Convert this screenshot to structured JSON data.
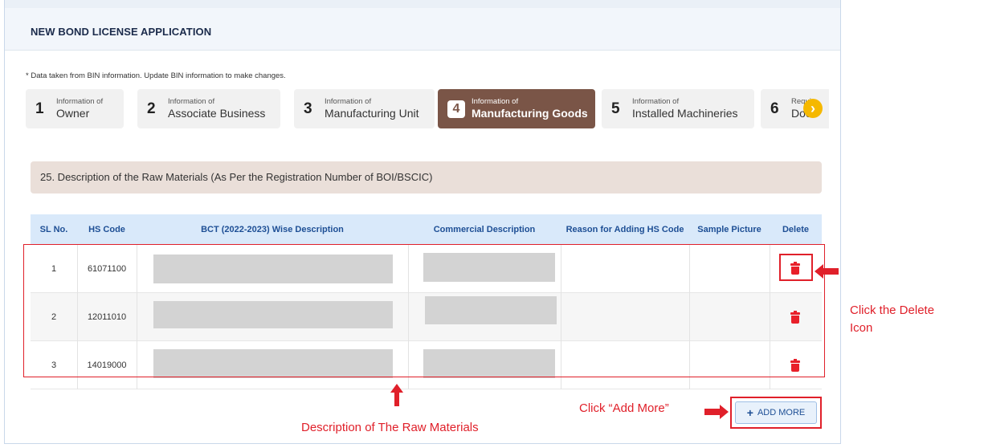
{
  "page": {
    "title": "NEW BOND LICENSE APPLICATION",
    "note": "* Data taken from BIN information. Update BIN information to make changes."
  },
  "steps": [
    {
      "num": "1",
      "small": "Information of",
      "big": "Owner",
      "active": false
    },
    {
      "num": "2",
      "small": "Information of",
      "big": "Associate Business",
      "active": false
    },
    {
      "num": "3",
      "small": "Information of",
      "big": "Manufacturing Unit",
      "active": false
    },
    {
      "num": "4",
      "small": "Information of",
      "big": "Manufacturing Goods",
      "active": true
    },
    {
      "num": "5",
      "small": "Information of",
      "big": "Installed Machineries",
      "active": false
    },
    {
      "num": "6",
      "small": "Requi",
      "big": "Docu",
      "active": false
    }
  ],
  "next_icon": "chevron-right-icon",
  "section": {
    "title": "25. Description of the Raw Materials (As Per the Registration Number of BOI/BSCIC)"
  },
  "table": {
    "columns": [
      "SL No.",
      "HS Code",
      "BCT (2022-2023) Wise Description",
      "Commercial Description",
      "Reason for Adding HS Code",
      "Sample Picture",
      "Delete"
    ],
    "rows": [
      {
        "sl": "1",
        "hs_code": "61071100",
        "reason": "",
        "sample": ""
      },
      {
        "sl": "2",
        "hs_code": "12011010",
        "reason": "",
        "sample": ""
      },
      {
        "sl": "3",
        "hs_code": "14019000",
        "reason": "",
        "sample": ""
      }
    ],
    "delete_icon": "trash-icon"
  },
  "add_more": {
    "label": "ADD MORE",
    "icon": "plus-icon"
  },
  "annotations": {
    "delete_line1": "Click the Delete",
    "delete_line2": "Icon",
    "add_more": "Click “Add More”",
    "raw_materials": "Description of The Raw Materials"
  },
  "colors": {
    "active_step": "#7a5547",
    "header_text": "#1e4f95",
    "annotation_red": "#e0202a",
    "trash_red": "#e8202a"
  }
}
